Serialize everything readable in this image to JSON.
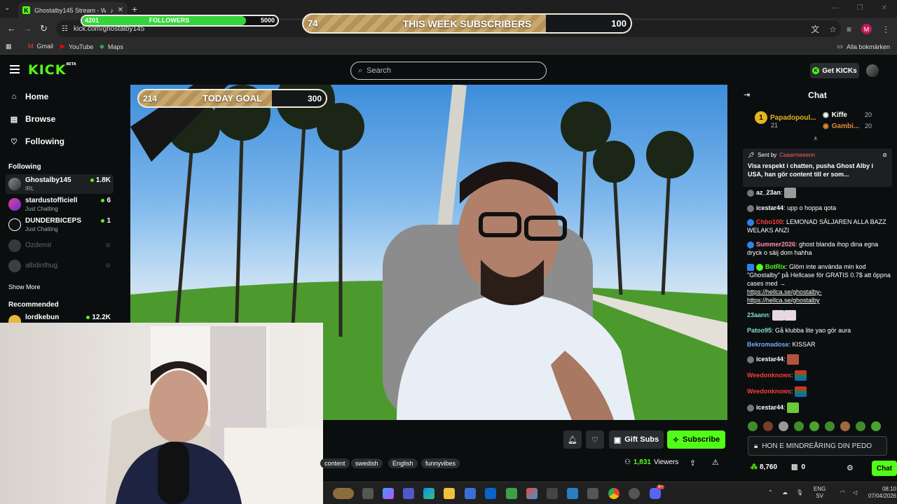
{
  "browser": {
    "tab_title": "Ghostalby145 Stream - Wa",
    "tab_close": "✕",
    "new_tab": "+",
    "url": "kick.com/ghostalby145",
    "bookmarks": [
      "Gmail",
      "YouTube",
      "Maps"
    ],
    "all_bookmarks": "Alla bokmärken",
    "profile_initial": "M"
  },
  "overlay": {
    "followers": {
      "current": "4201",
      "label": "FOLLOWERS",
      "target": "5000",
      "progress": 0.84
    },
    "week_subs": {
      "current": "74",
      "label": "THIS WEEK SUBSCRIBERS",
      "target": "100",
      "progress": 0.74
    },
    "today_goal": {
      "current": "214",
      "label": "TODAY GOAL",
      "target": "300",
      "progress": 0.71
    }
  },
  "header": {
    "logo": "KICK",
    "logo_badge": "BETA",
    "search_placeholder": "Search",
    "get_kicks": "Get KICKs"
  },
  "sidebar": {
    "nav": [
      {
        "label": "Home",
        "icon": "home-icon"
      },
      {
        "label": "Browse",
        "icon": "browse-icon"
      },
      {
        "label": "Following",
        "icon": "heart-icon"
      }
    ],
    "following_title": "Following",
    "following": [
      {
        "name": "Ghostalby145",
        "category": "IRL",
        "viewers": "1.8K",
        "live": true
      },
      {
        "name": "stardustofficiell",
        "category": "Just Chatting",
        "viewers": "6",
        "live": true
      },
      {
        "name": "DUNDERBICEPS",
        "category": "Just Chatting",
        "viewers": "1",
        "live": true
      },
      {
        "name": "Ozdemir",
        "live": false
      },
      {
        "name": "albdinthug",
        "live": false
      }
    ],
    "show_more": "Show More",
    "recommended_title": "Recommended",
    "recommended": [
      {
        "name": "lordkebun",
        "viewers": "12.2K"
      }
    ]
  },
  "stream": {
    "gift_subs": "Gift Subs",
    "subscribe": "Subscribe",
    "tags": [
      "content",
      "swedish",
      "English",
      "funnyvibes"
    ],
    "viewers": "1,831",
    "viewers_label": "Viewers"
  },
  "chat": {
    "title": "Chat",
    "top_gifters": [
      {
        "name": "Papadopoul...",
        "count": "21"
      },
      {
        "name": "Kiffe",
        "count": "20"
      },
      {
        "name": "Gambi...",
        "count": "20"
      }
    ],
    "pinned": {
      "sent_by_label": "Sent by",
      "sender": "Caaarmeeenn",
      "text": "Visa respekt i chatten, pusha Ghost Alby i USA, han gör content till er som..."
    },
    "messages": [
      {
        "user": "az_23an",
        "text": "",
        "color": "#ffffff"
      },
      {
        "user": "icestar44",
        "text": "upp o hoppa qota",
        "color": "#ffffff"
      },
      {
        "user": "Chbo100",
        "text": "LEMONAD SÄLJAREN ALLA BAZZ WELAKS ANZI",
        "color": "#ff3b3b"
      },
      {
        "user": "Summer2026",
        "text": "ghost blanda ihop dina egna dryck o säij dom hahha",
        "color": "#ff8fb1"
      },
      {
        "user": "BotRix",
        "text": "Glöm inte använda min kod \"Ghostalby\" på Hellcase för GRATIS 0.7$ att öppna cases med →",
        "link": "https://hellca.se/ghostalby-https://hellca.se/ghostalby",
        "color": "#53fc18"
      },
      {
        "user": "23aann",
        "text": "",
        "color": "#7fe0d4"
      },
      {
        "user": "Patoo95",
        "text": "Gå klubba lite yao gör aura",
        "color": "#7fe0d4"
      },
      {
        "user": "Bekromadose",
        "text": "KISSAR",
        "color": "#7aa7ff"
      },
      {
        "user": "icestar44",
        "text": "",
        "color": "#ffffff"
      },
      {
        "user": "Weedonknows",
        "text": "",
        "color": "#ff3b3b"
      },
      {
        "user": "Weedonknows",
        "text": "",
        "color": "#ff3b3b"
      },
      {
        "user": "icestar44",
        "text": "",
        "color": "#ffffff"
      }
    ],
    "input_value": "HON E MINDREÅRING DIN PEDO",
    "points": "8,760",
    "kicks": "0",
    "send": "Chat"
  },
  "taskbar": {
    "lang": "ENG",
    "lang_sub": "SV",
    "time": "08:10",
    "date": "07/04/2026",
    "discord_badge": "9+"
  }
}
